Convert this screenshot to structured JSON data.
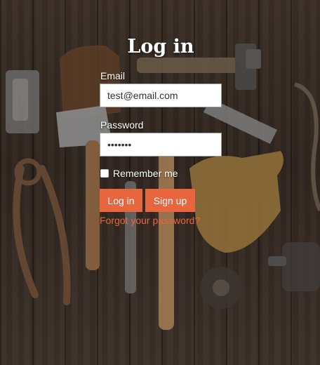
{
  "login": {
    "title": "Log in",
    "email_label": "Email",
    "email_value": "test@email.com",
    "password_label": "Password",
    "password_value": "•••••••",
    "remember_label": "Remember me",
    "remember_checked": false,
    "login_button": "Log in",
    "signup_button": "Sign up",
    "forgot_link": "Forgot your password?"
  },
  "colors": {
    "accent": "#e8663d",
    "background": "#2f251e",
    "text": "#ffffff"
  }
}
